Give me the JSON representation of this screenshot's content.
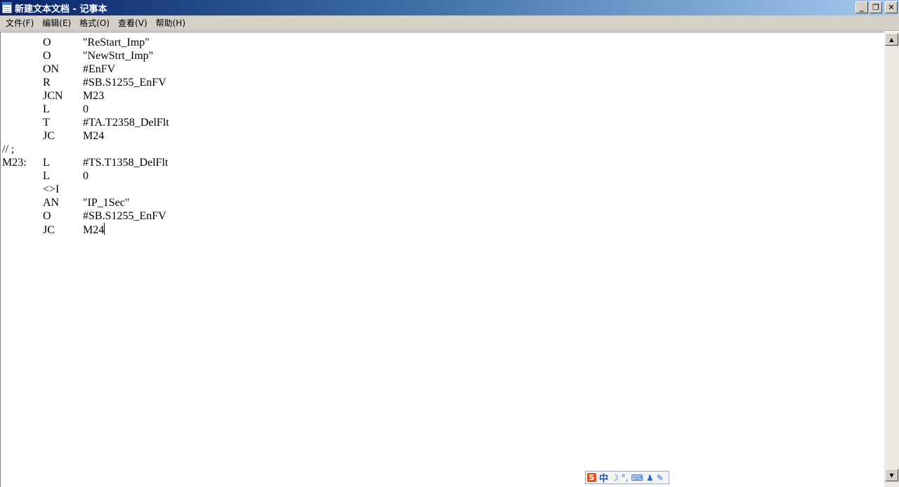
{
  "window": {
    "title": "新建文本文档 - 记事本",
    "minimize_glyph": "_",
    "restore_glyph": "❐",
    "close_glyph": "✕"
  },
  "menu": {
    "items": [
      "文件(F)",
      "编辑(E)",
      "格式(O)",
      "查看(V)",
      "帮助(H)"
    ]
  },
  "editor": {
    "lines": [
      {
        "label": "",
        "op": "O",
        "arg": "\"ReStart_Imp\""
      },
      {
        "label": "",
        "op": "O",
        "arg": "\"NewStrt_Imp\""
      },
      {
        "label": "",
        "op": "ON",
        "arg": "#EnFV"
      },
      {
        "label": "",
        "op": "R",
        "arg": "#SB.S1255_EnFV"
      },
      {
        "label": "",
        "op": "JCN",
        "arg": "M23"
      },
      {
        "label": "",
        "op": "L",
        "arg": "0"
      },
      {
        "label": "",
        "op": "T",
        "arg": "#TA.T2358_DelFlt"
      },
      {
        "label": "",
        "op": "JC",
        "arg": "M24"
      },
      {
        "label": "// ;",
        "op": "",
        "arg": ""
      },
      {
        "label": "M23:",
        "op": "L",
        "arg": "#TS.T1358_DelFlt"
      },
      {
        "label": "",
        "op": "L",
        "arg": "0"
      },
      {
        "label": "",
        "op": "<>I",
        "arg": ""
      },
      {
        "label": "",
        "op": "AN",
        "arg": "\"IP_1Sec\""
      },
      {
        "label": "",
        "op": "O",
        "arg": "#SB.S1255_EnFV"
      },
      {
        "label": "",
        "op": "JC",
        "arg": "M24"
      }
    ]
  },
  "scrollbar": {
    "up_glyph": "▲",
    "down_glyph": "▼"
  },
  "ime": {
    "logo": "S",
    "mode": "中",
    "moon": "☽",
    "punct": "°,",
    "keyboard": "⌨",
    "user": "♟",
    "tool": "✎"
  }
}
